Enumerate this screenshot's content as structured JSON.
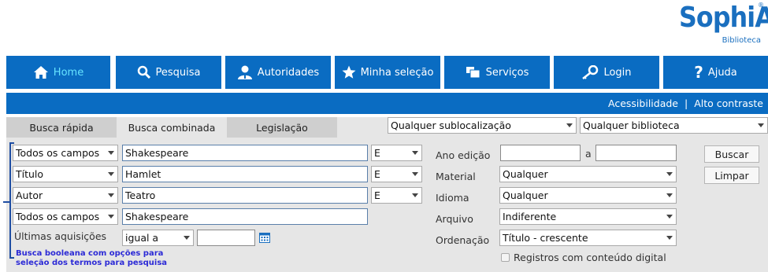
{
  "logo": {
    "brand": "SophiA",
    "sub": "Biblioteca",
    "reg": "®"
  },
  "nav": [
    {
      "label": "Home",
      "icon": "home-icon"
    },
    {
      "label": "Pesquisa",
      "icon": "search-icon"
    },
    {
      "label": "Autoridades",
      "icon": "authorities-icon"
    },
    {
      "label": "Minha seleção",
      "icon": "star-icon"
    },
    {
      "label": "Serviços",
      "icon": "services-icon"
    },
    {
      "label": "Login",
      "icon": "key-icon"
    },
    {
      "label": "Ajuda",
      "icon": "help-icon"
    }
  ],
  "topbar": {
    "accessibility": "Acessibilidade",
    "separator": "|",
    "contrast": "Alto contraste"
  },
  "tabs": [
    "Busca rápida",
    "Busca combinada",
    "Legislação"
  ],
  "filters": {
    "sublocation": "Qualquer sublocalização",
    "library": "Qualquer biblioteca"
  },
  "search_rows": [
    {
      "field": "Todos os campos",
      "term": "Shakespeare",
      "op": "E"
    },
    {
      "field": "Título",
      "term": "Hamlet",
      "op": "E"
    },
    {
      "field": "Autor",
      "term": "Teatro",
      "op": "E"
    },
    {
      "field": "Todos os campos",
      "term": "Shakespeare"
    }
  ],
  "recent": {
    "label": "Últimas aquisições",
    "comparator": "igual a",
    "value": ""
  },
  "hint": "Busca booleana com opções  para seleção dos termos para pesquisa",
  "right_form": {
    "year_label": "Ano edição",
    "year_from": "",
    "year_sep": "a",
    "year_to": "",
    "material_label": "Material",
    "material": "Qualquer",
    "language_label": "Idioma",
    "language": "Qualquer",
    "file_label": "Arquivo",
    "file": "Indiferente",
    "order_label": "Ordenação",
    "order": "Título - crescente",
    "digital_label": "Registros com conteúdo digital"
  },
  "buttons": {
    "search": "Buscar",
    "clear": "Limpar"
  },
  "colors": {
    "nav": "#0a6cc2",
    "active_nav_text": "#66e3ff",
    "panel": "#e6e6e6",
    "hint": "#2c2ad6"
  }
}
